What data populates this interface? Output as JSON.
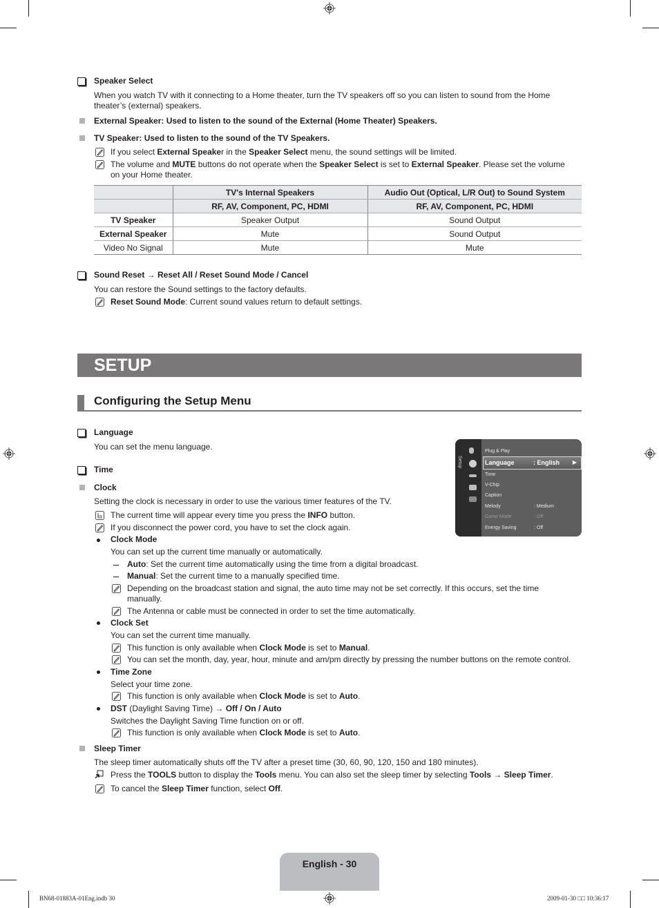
{
  "speaker_select": {
    "heading": "Speaker Select",
    "intro_line1": "When you watch TV with it connecting to a Home theater, turn the TV speakers off so you can listen to sound from the Home",
    "intro_line2": "theater’s (external) speakers.",
    "external_item": "External Speaker: Used to listen to the sound of the External (Home Theater) Speakers.",
    "tv_item": "TV Speaker: Used to listen to the sound of the TV Speakers.",
    "note1": {
      "a": "If you select ",
      "b1": "External Speake",
      "c": "r in the ",
      "b2": "Speaker Select",
      "d": " menu, the sound settings will be limited."
    },
    "note2": {
      "a": "The volume and ",
      "b1": "MUTE",
      "c": " buttons do not operate when the ",
      "b2": "Speaker Select",
      "d": " is set to ",
      "b3": "External Speaker",
      "e": ". Please set the volume",
      "line2": "on your Home theater."
    },
    "table": {
      "header_row1": [
        "",
        "TV's Internal Speakers",
        "Audio Out (Optical, L/R Out) to Sound System"
      ],
      "header_row2": [
        "",
        "RF, AV, Component, PC, HDMI",
        "RF, AV, Component, PC, HDMI"
      ],
      "rows": [
        [
          "TV Speaker",
          "Speaker Output",
          "Sound Output"
        ],
        [
          "External Speaker",
          "Mute",
          "Sound Output"
        ],
        [
          "Video No Signal",
          "Mute",
          "Mute"
        ]
      ]
    }
  },
  "sound_reset": {
    "heading": "Sound Reset → Reset All / Reset Sound Mode / Cancel",
    "intro": "You can restore the Sound settings to the factory defaults.",
    "note": {
      "b": "Reset Sound Mode",
      "a": ": Current sound values return to default settings."
    }
  },
  "section_title": "SETUP",
  "subsection_title": "Configuring the Setup Menu",
  "language": {
    "heading": "Language",
    "intro": "You can set the menu language."
  },
  "time": {
    "heading": "Time",
    "clock": {
      "heading": "Clock",
      "intro": "Setting the clock is necessary in order to use the various timer features of the TV.",
      "info_note": {
        "a": "The current time will appear every time you press the ",
        "b": "INFO",
        "c": " button."
      },
      "note": "If you disconnect the power cord, you have to set the clock again.",
      "clock_mode": {
        "heading": "Clock Mode",
        "intro": "You can set up the current time manually or automatically.",
        "auto": {
          "b": "Auto",
          "a": ": Set the current time automatically using the time from a digital broadcast."
        },
        "manual": {
          "b": "Manual",
          "a": ": Set the current time to a manually specified time."
        },
        "note1_line1": "Depending on the broadcast station and signal, the auto time may not be set correctly. If this occurs, set the time",
        "note1_line2": "manually.",
        "note2": "The Antenna or cable must be connected in order to set the time automatically."
      },
      "clock_set": {
        "heading": "Clock Set",
        "intro": "You can set the current time manually.",
        "note1": {
          "a": "This function is only available when ",
          "b1": "Clock Mode",
          "c": " is set to ",
          "b2": "Manual",
          "d": "."
        },
        "note2": "You can set the month, day, year, hour, minute and am/pm directly by pressing the number buttons on the remote control."
      },
      "time_zone": {
        "heading": "Time Zone",
        "intro": "Select your time zone.",
        "note": {
          "a": "This function is only available when ",
          "b1": "Clock Mode",
          "c": " is set to ",
          "b2": "Auto",
          "d": "."
        }
      },
      "dst": {
        "heading_b": "DST",
        "heading_a": " (Daylight Saving Time) → ",
        "heading_opts": "Off / On / Auto",
        "intro": "Switches the Daylight Saving Time function on or off.",
        "note": {
          "a": "This function is only available when ",
          "b1": "Clock Mode",
          "c": " is set to ",
          "b2": "Auto",
          "d": "."
        }
      }
    },
    "sleep_timer": {
      "heading": "Sleep Timer",
      "intro": "The sleep timer automatically shuts off the TV after a preset time (30, 60, 90, 120, 150 and 180 minutes).",
      "tools_note": {
        "a": "Press the ",
        "b1": "TOOLS",
        "c": " button to display the ",
        "b2": "Tools",
        "d": " menu. You can also set the sleep timer by selecting ",
        "b3": "Tools → Sleep Timer",
        "e": "."
      },
      "note": {
        "a": "To cancel the ",
        "b1": "Sleep Timer",
        "c": " function, select ",
        "b2": "Off",
        "d": "."
      }
    }
  },
  "osd_menu": {
    "side_label": "Setup",
    "items": [
      {
        "label": "Plug & Play",
        "value": ""
      },
      {
        "label": "Language",
        "value": ": English",
        "selected": true
      },
      {
        "label": "Time",
        "value": ""
      },
      {
        "label": "V-Chip",
        "value": ""
      },
      {
        "label": "Caption",
        "value": ""
      },
      {
        "label": "Melody",
        "value": ": Medium"
      },
      {
        "label": "Game Mode",
        "value": ": Off",
        "disabled": true
      },
      {
        "label": "Energy Saving",
        "value": ": Off"
      }
    ]
  },
  "footer": {
    "page_label": "English - 30",
    "file_slug": "BN68-01883A-01Eng.indb   30",
    "timestamp": "2009-01-30   □□ 10:36:17"
  }
}
